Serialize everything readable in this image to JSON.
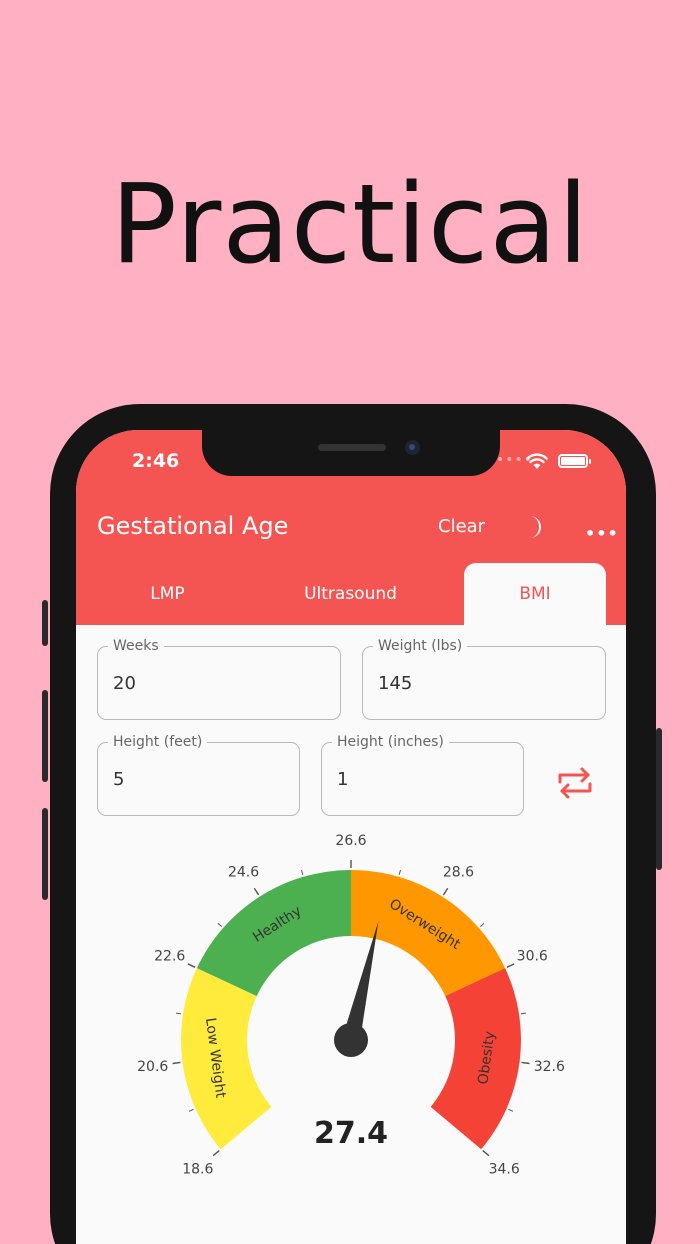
{
  "headline": "Practical",
  "status": {
    "time": "2:46"
  },
  "appbar": {
    "title": "Gestational Age",
    "clear_label": "Clear"
  },
  "tabs": [
    {
      "label": "LMP",
      "active": false
    },
    {
      "label": "Ultrasound",
      "active": false
    },
    {
      "label": "BMI",
      "active": true
    }
  ],
  "fields": {
    "weeks": {
      "label": "Weeks",
      "value": "20"
    },
    "weight": {
      "label": "Weight (lbs)",
      "value": "145"
    },
    "height_feet": {
      "label": "Height (feet)",
      "value": "5"
    },
    "height_inches": {
      "label": "Height (inches)",
      "value": "1"
    }
  },
  "gauge": {
    "value": 27.4,
    "value_label": "27.4",
    "min": 18.6,
    "max": 34.6,
    "tick_labels": [
      "18.6",
      "20.6",
      "22.6",
      "24.6",
      "26.6",
      "28.6",
      "30.6",
      "32.6",
      "34.6"
    ],
    "ranges": [
      {
        "name": "Low Weight",
        "from": 18.6,
        "to": 22.6,
        "color": "#ffeb3b"
      },
      {
        "name": "Healthy",
        "from": 22.6,
        "to": 26.6,
        "color": "#4caf50"
      },
      {
        "name": "Overweight",
        "from": 26.6,
        "to": 30.6,
        "color": "#ff9800"
      },
      {
        "name": "Obesity",
        "from": 30.6,
        "to": 34.6,
        "color": "#f44336"
      }
    ]
  },
  "colors": {
    "accent": "#f45452",
    "background": "#ffb0c3"
  }
}
